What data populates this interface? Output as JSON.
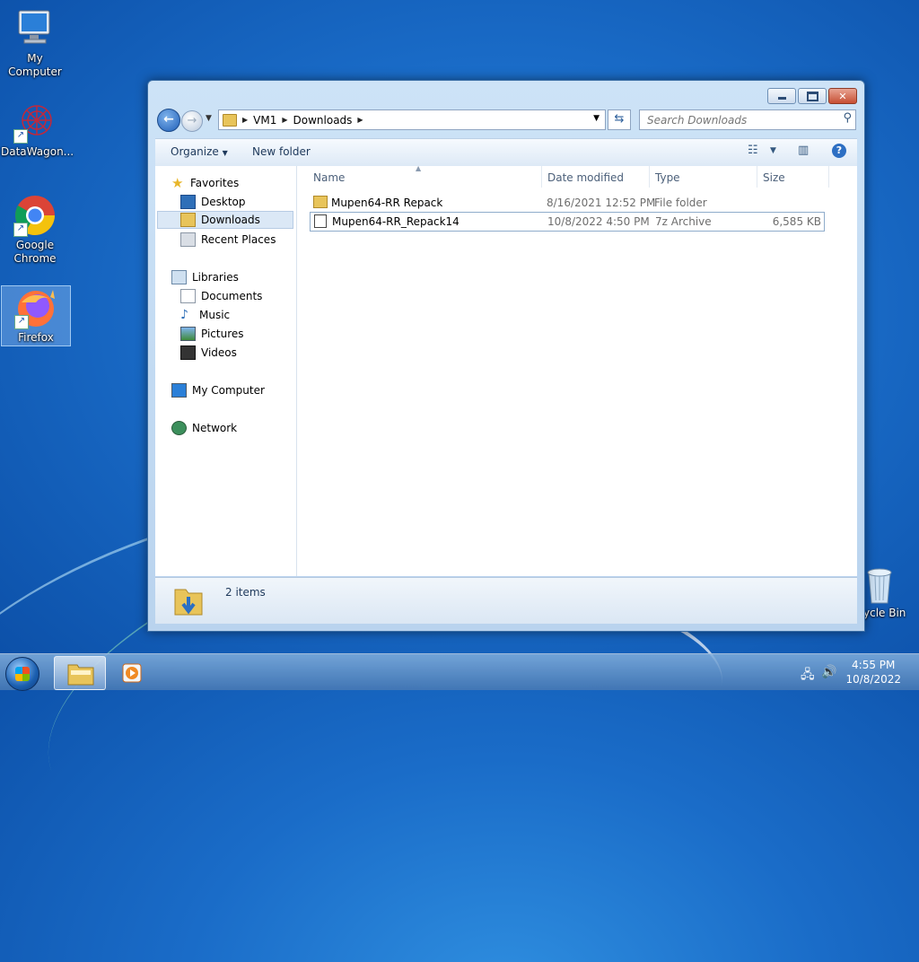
{
  "desktop": {
    "icons": [
      {
        "label": "My Computer"
      },
      {
        "label": "DataWagon..."
      },
      {
        "label": "Google Chrome"
      },
      {
        "label": "Firefox"
      },
      {
        "label": "ycle Bin"
      }
    ]
  },
  "window": {
    "address": {
      "crumbs": [
        "VM1",
        "Downloads"
      ]
    },
    "search": {
      "placeholder": "Search Downloads"
    },
    "toolbar": {
      "organize": "Organize",
      "new_folder": "New folder"
    },
    "nav": {
      "favorites": "Favorites",
      "desktop": "Desktop",
      "downloads": "Downloads",
      "recent": "Recent Places",
      "libraries": "Libraries",
      "documents": "Documents",
      "music": "Music",
      "pictures": "Pictures",
      "videos": "Videos",
      "computer": "My Computer",
      "network": "Network"
    },
    "columns": {
      "name": "Name",
      "date": "Date modified",
      "type": "Type",
      "size": "Size"
    },
    "files": [
      {
        "name": "Mupen64-RR Repack",
        "date": "8/16/2021 12:52 PM",
        "type": "File folder",
        "size": ""
      },
      {
        "name": "Mupen64-RR_Repack14",
        "date": "10/8/2022 4:50 PM",
        "type": "7z Archive",
        "size": "6,585 KB"
      }
    ],
    "status": {
      "items": "2 items"
    }
  },
  "taskbar": {
    "time": "4:55 PM",
    "date": "10/8/2022"
  }
}
